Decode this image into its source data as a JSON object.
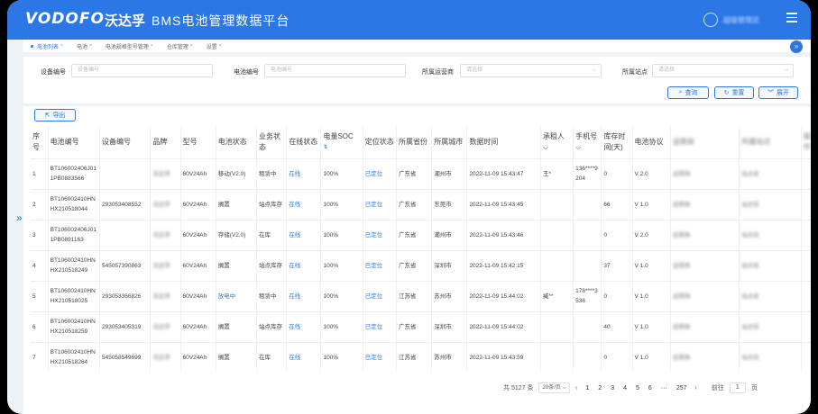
{
  "header": {
    "logo": "VODOFO",
    "logo_cn": "沃达孚",
    "title": "BMS电池管理数据平台",
    "user_name": "超级管理员"
  },
  "tabs": [
    {
      "label": "电池列表",
      "active": true
    },
    {
      "label": "电池"
    },
    {
      "label": "电池规格型号管理"
    },
    {
      "label": "仓库管理"
    },
    {
      "label": "设置"
    }
  ],
  "filter": {
    "device_label": "设备编号",
    "device_placeholder": "设备编号",
    "battery_label": "电池编号",
    "battery_placeholder": "电池编号",
    "operator_label": "所属运营商",
    "operator_placeholder": "请选择",
    "site_label": "所属站点",
    "site_placeholder": "请选择",
    "query_btn": "查询",
    "reset_btn": "重置",
    "expand_btn": "展开"
  },
  "toolbar": {
    "export_btn": "导出"
  },
  "table": {
    "columns": [
      "序号",
      "电池编号",
      "设备编号",
      "品牌",
      "型号",
      "电池状态",
      "业务状态",
      "在线状态",
      "电量SOC",
      "定位状态",
      "所属省份",
      "所属城市",
      "数据时间",
      "承租人",
      "手机号",
      "库存时间(天)",
      "电池协议",
      "运营商",
      "所属站点",
      "操作"
    ],
    "rows": [
      {
        "no": "1",
        "battery": "BT106002406J011PB0883566",
        "device": "",
        "brand": "沃达孚",
        "model": "60V24Ah",
        "status": "移动(V2.0)",
        "status_blue": false,
        "biz": "租赁中",
        "online": "在线",
        "soc": "100%",
        "loc": "已定位",
        "province": "广东省",
        "city": "潮州市",
        "time": "2022-11-09 15:43:47",
        "renter": "王*",
        "phone": "136****9204",
        "stock": "0",
        "proto": "V 2.0",
        "op": "运营商",
        "site": "站点名"
      },
      {
        "no": "2",
        "battery": "BT106002410HNHX210518044",
        "device": "293053408552",
        "brand": "沃达孚",
        "model": "60V24Ah",
        "status": "搁置",
        "status_blue": false,
        "biz": "站点库存",
        "online": "在线",
        "soc": "100%",
        "loc": "已定位",
        "province": "广东省",
        "city": "东莞市",
        "time": "2022-11-09 15:43:45",
        "renter": "",
        "phone": "",
        "stock": "66",
        "proto": "V 1.0",
        "op": "运营商",
        "site": "站点名"
      },
      {
        "no": "3",
        "battery": "BT106002406J011PB0891163",
        "device": "",
        "brand": "沃达孚",
        "model": "60V24Ah",
        "status": "存储(V2.0)",
        "status_blue": false,
        "biz": "在库",
        "online": "在线",
        "soc": "100%",
        "loc": "已定位",
        "province": "广东省",
        "city": "潮州市",
        "time": "2022-11-09 15:43:46",
        "renter": "",
        "phone": "",
        "stock": "0",
        "proto": "V 2.0",
        "op": "运营商",
        "site": "站点名"
      },
      {
        "no": "4",
        "battery": "BT106002410HNHX210518249",
        "device": "545057390863",
        "brand": "沃达孚",
        "model": "60V24Ah",
        "status": "搁置",
        "status_blue": false,
        "biz": "站点库存",
        "online": "在线",
        "soc": "100%",
        "loc": "已定位",
        "province": "广东省",
        "city": "深圳市",
        "time": "2022-11-09 15:42:15",
        "renter": "",
        "phone": "",
        "stock": "37",
        "proto": "V 1.0",
        "op": "运营商",
        "site": "站点名"
      },
      {
        "no": "5",
        "battery": "BT106002410HNHX210518025",
        "device": "293053366826",
        "brand": "沃达孚",
        "model": "60V24Ah",
        "status": "放电中",
        "status_blue": true,
        "biz": "租赁中",
        "online": "在线",
        "soc": "100%",
        "loc": "已定位",
        "province": "江苏省",
        "city": "苏州市",
        "time": "2022-11-09 15:44:02",
        "renter": "臧**",
        "phone": "178****3536",
        "stock": "0",
        "proto": "V 1.0",
        "op": "运营商",
        "site": "站点名"
      },
      {
        "no": "6",
        "battery": "BT106002410HNHX210518259",
        "device": "293053405319",
        "brand": "沃达孚",
        "model": "60V24Ah",
        "status": "搁置",
        "status_blue": false,
        "biz": "站点库存",
        "online": "在线",
        "soc": "100%",
        "loc": "已定位",
        "province": "广东省",
        "city": "深圳市",
        "time": "2022-11-09 15:44:02",
        "renter": "",
        "phone": "",
        "stock": "40",
        "proto": "V 1.0",
        "op": "运营商",
        "site": "站点名"
      },
      {
        "no": "7",
        "battery": "BT106002410HNHX210518264",
        "device": "545058549699",
        "brand": "沃达孚",
        "model": "60V24Ah",
        "status": "搁置",
        "status_blue": false,
        "biz": "在库",
        "online": "在线",
        "soc": "100%",
        "loc": "已定位",
        "province": "江苏省",
        "city": "苏州市",
        "time": "2022-11-09 15:43:59",
        "renter": "",
        "phone": "",
        "stock": "0",
        "proto": "V 1.0",
        "op": "运营商",
        "site": "站点名"
      }
    ]
  },
  "pagination": {
    "total": "共 5127 条",
    "page_size": "20条/页",
    "pages": [
      "1",
      "2",
      "3",
      "4",
      "5",
      "6",
      "···",
      "257"
    ],
    "goto_label": "前往",
    "goto_value": "1",
    "page_unit": "页"
  }
}
